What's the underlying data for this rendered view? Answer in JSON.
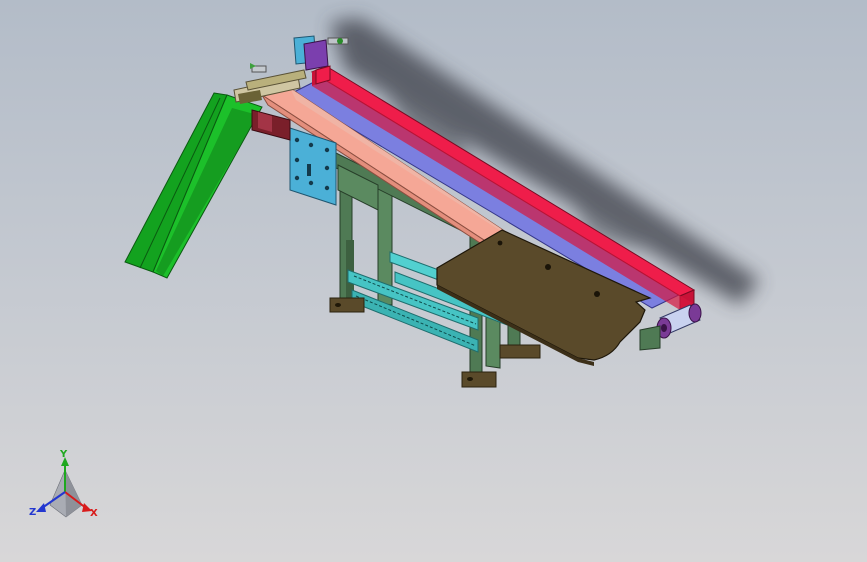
{
  "triad": {
    "x_label": "X",
    "y_label": "Y",
    "z_label": "Z",
    "x_color": "#d81b1b",
    "y_color": "#1ea81e",
    "z_color": "#2337d0"
  },
  "colors": {
    "background_top": "#b3bcc8",
    "background_bottom": "#d8d7d8",
    "belt_rail_red": "#ef1d4a",
    "belt_blue": "#7b7fe0",
    "belt_rail_salmon": "#f5a796",
    "frame_green": "#4f7a54",
    "frame_cyan": "#46c4c4",
    "table_plate": "#5a4a2a",
    "chute_green": "#16a021",
    "motor_plate_blue": "#4bb0d7",
    "roller_purple": "#7a3a96"
  }
}
